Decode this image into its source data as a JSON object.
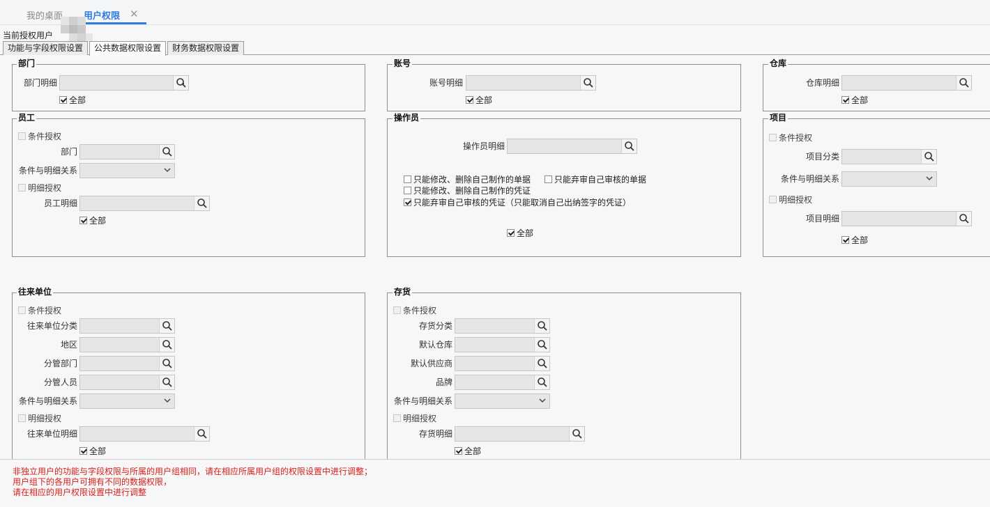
{
  "top_tabs": [
    {
      "label": "我的桌面"
    },
    {
      "label": "用户权限",
      "close": "✕"
    }
  ],
  "current_user_label": "当前授权用户",
  "sub_tabs": [
    {
      "label": "功能与字段权限设置"
    },
    {
      "label": "公共数据权限设置"
    },
    {
      "label": "财务数据权限设置"
    }
  ],
  "common": {
    "all_label": "全部",
    "cond_label": "条件授权",
    "detail_label": "明细授权",
    "relation_label": "条件与明细关系"
  },
  "dept": {
    "title": "部门",
    "detail_label": "部门明细"
  },
  "account": {
    "title": "账号",
    "detail_label": "账号明细"
  },
  "warehouse": {
    "title": "仓库",
    "detail_label": "仓库明细"
  },
  "employee": {
    "title": "员工",
    "dept_label": "部门",
    "detail_label": "员工明细"
  },
  "operator": {
    "title": "操作员",
    "detail_label": "操作员明细",
    "opt1": "只能修改、删除自己制作的单据",
    "opt2": "只能弃审自己审核的单据",
    "opt3": "只能修改、删除自己制作的凭证",
    "opt4": "只能弃审自己审核的凭证（只能取消自己出纳签字的凭证）"
  },
  "project": {
    "title": "项目",
    "category_label": "项目分类",
    "detail_label": "项目明细"
  },
  "partner": {
    "title": "往来单位",
    "category_label": "往来单位分类",
    "region_label": "地区",
    "dept_label": "分管部门",
    "staff_label": "分管人员",
    "detail_label": "往来单位明细"
  },
  "inventory": {
    "title": "存货",
    "category_label": "存货分类",
    "warehouse_label": "默认仓库",
    "supplier_label": "默认供应商",
    "brand_label": "品牌",
    "detail_label": "存货明细"
  },
  "notes": [
    "非独立用户的功能与字段权限与所属的用户组相同，请在相应所属用户组的权限设置中进行调整；",
    "用户组下的各用户可拥有不同的数据权限，",
    "请在相应的用户权限设置中进行调整"
  ],
  "icons": {
    "lookup": "search-lookup-icon",
    "dropdown": "chevron-down-icon"
  },
  "colors": {
    "accent": "#2e7ce0",
    "note": "#d6201b"
  }
}
